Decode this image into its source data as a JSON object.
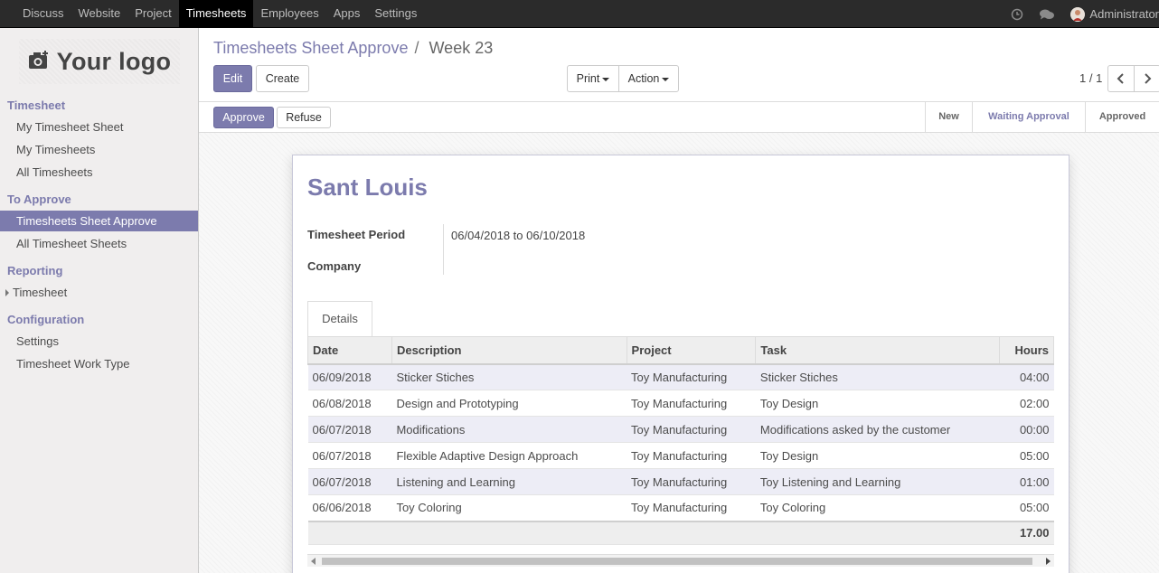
{
  "topbar": {
    "menu": [
      "Discuss",
      "Website",
      "Project",
      "Timesheets",
      "Employees",
      "Apps",
      "Settings"
    ],
    "active": "Timesheets",
    "user_name": "Administrator"
  },
  "sidebar": {
    "logo_text": "Your logo",
    "sections": [
      {
        "title": "Timesheet",
        "items": [
          "My Timesheet Sheet",
          "My Timesheets",
          "All Timesheets"
        ]
      },
      {
        "title": "To Approve",
        "items": [
          "Timesheets Sheet Approve",
          "All Timesheet Sheets"
        ]
      },
      {
        "title": "Reporting",
        "items": [
          "Timesheet"
        ]
      },
      {
        "title": "Configuration",
        "items": [
          "Settings",
          "Timesheet Work Type"
        ]
      }
    ],
    "active_item": "Timesheets Sheet Approve"
  },
  "control": {
    "breadcrumb_link": "Timesheets Sheet Approve",
    "breadcrumb_sep": "/",
    "breadcrumb_current": "Week 23",
    "edit_label": "Edit",
    "create_label": "Create",
    "print_label": "Print",
    "action_label": "Action",
    "pager": "1 / 1"
  },
  "statusbar": {
    "approve_label": "Approve",
    "refuse_label": "Refuse",
    "stages": [
      "New",
      "Waiting Approval",
      "Approved"
    ],
    "current_stage": "Waiting Approval"
  },
  "sheet": {
    "title": "Sant Louis",
    "period_label": "Timesheet Period",
    "period_value": "06/04/2018 to 06/10/2018",
    "company_label": "Company",
    "company_value": "",
    "tab_label": "Details",
    "columns": [
      "Date",
      "Description",
      "Project",
      "Task",
      "Hours"
    ],
    "rows": [
      {
        "date": "06/09/2018",
        "description": "Sticker Stiches",
        "project": "Toy Manufacturing",
        "task": "Sticker Stiches",
        "hours": "04:00"
      },
      {
        "date": "06/08/2018",
        "description": "Design and Prototyping",
        "project": "Toy Manufacturing",
        "task": "Toy Design",
        "hours": "02:00"
      },
      {
        "date": "06/07/2018",
        "description": "Modifications",
        "project": "Toy Manufacturing",
        "task": "Modifications asked by the customer",
        "hours": "00:00"
      },
      {
        "date": "06/07/2018",
        "description": "Flexible Adaptive Design Approach",
        "project": "Toy Manufacturing",
        "task": "Toy Design",
        "hours": "05:00"
      },
      {
        "date": "06/07/2018",
        "description": "Listening and Learning",
        "project": "Toy Manufacturing",
        "task": "Toy Listening and Learning",
        "hours": "01:00"
      },
      {
        "date": "06/06/2018",
        "description": "Toy Coloring",
        "project": "Toy Manufacturing",
        "task": "Toy Coloring",
        "hours": "05:00"
      }
    ],
    "total_hours": "17.00"
  },
  "colors": {
    "accent": "#7c7bad",
    "topbar": "#2b2b2b",
    "sidebar": "#f0eeee"
  }
}
